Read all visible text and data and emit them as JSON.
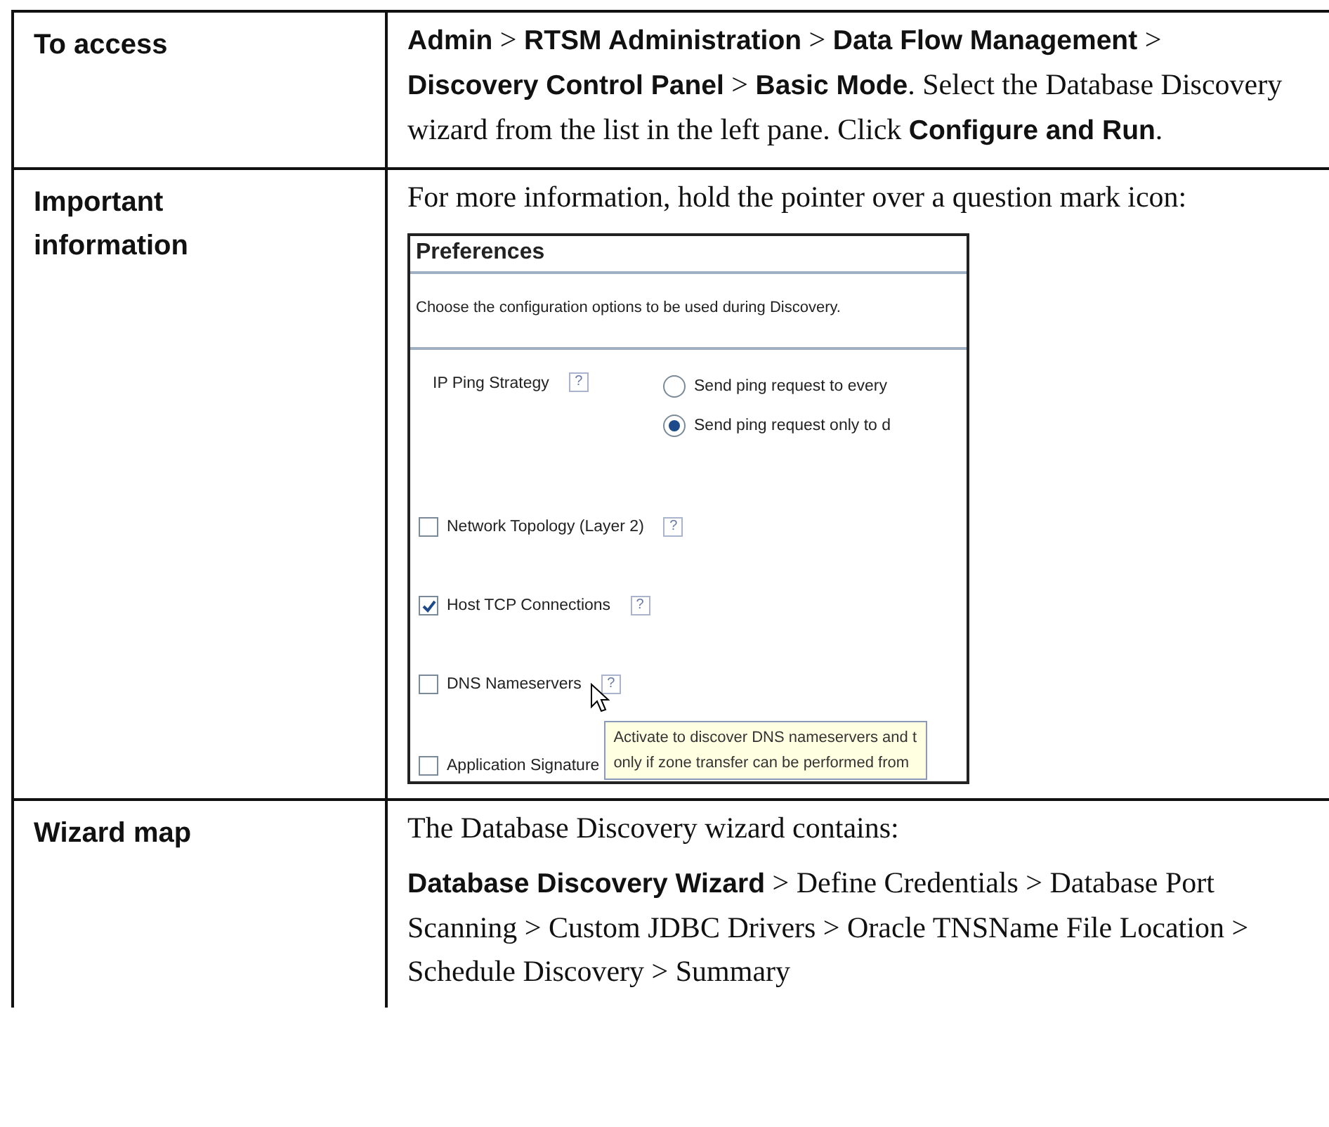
{
  "rows": [
    {
      "label": "To access",
      "paragraphs": [
        "**Admin** > **RTSM Administration** > **Data Flow Management** > **Discovery Control Panel** > **Basic Mode**. Select the Database Discovery wizard from the list in the left pane. Click **Configure and Run**."
      ]
    },
    {
      "label": "Important information",
      "paragraphs": [
        "For more information, hold the pointer over a question mark icon:"
      ],
      "screenshot": {
        "title": "Preferences",
        "description": "Choose the configuration options to be used during Discovery.",
        "options": [
          {
            "kind": "radio_group",
            "label": "IP Ping Strategy",
            "help": "?",
            "choices": [
              {
                "label": "Send ping request to every",
                "selected": false
              },
              {
                "label": "Send ping request only to d",
                "selected": true
              }
            ]
          },
          {
            "kind": "checkbox",
            "label": "Network Topology (Layer 2)",
            "help": "?",
            "checked": false
          },
          {
            "kind": "checkbox",
            "label": "Host TCP Connections",
            "help": "?",
            "checked": true
          },
          {
            "kind": "checkbox",
            "label": "DNS Nameservers",
            "help": "?",
            "checked": false,
            "hovered": true
          },
          {
            "kind": "checkbox",
            "label": "Application Signature",
            "checked": false
          }
        ],
        "tooltip": [
          "Activate to discover DNS nameservers and t",
          "only if zone transfer can be performed from"
        ]
      }
    },
    {
      "label": "Wizard map",
      "paragraphs": [
        "The Database Discovery wizard contains:",
        "**Database Discovery Wizard** > Define Credentials > Database Port Scanning > Custom JDBC Drivers > Oracle TNSName File Location > Schedule Discovery > Summary"
      ]
    }
  ]
}
